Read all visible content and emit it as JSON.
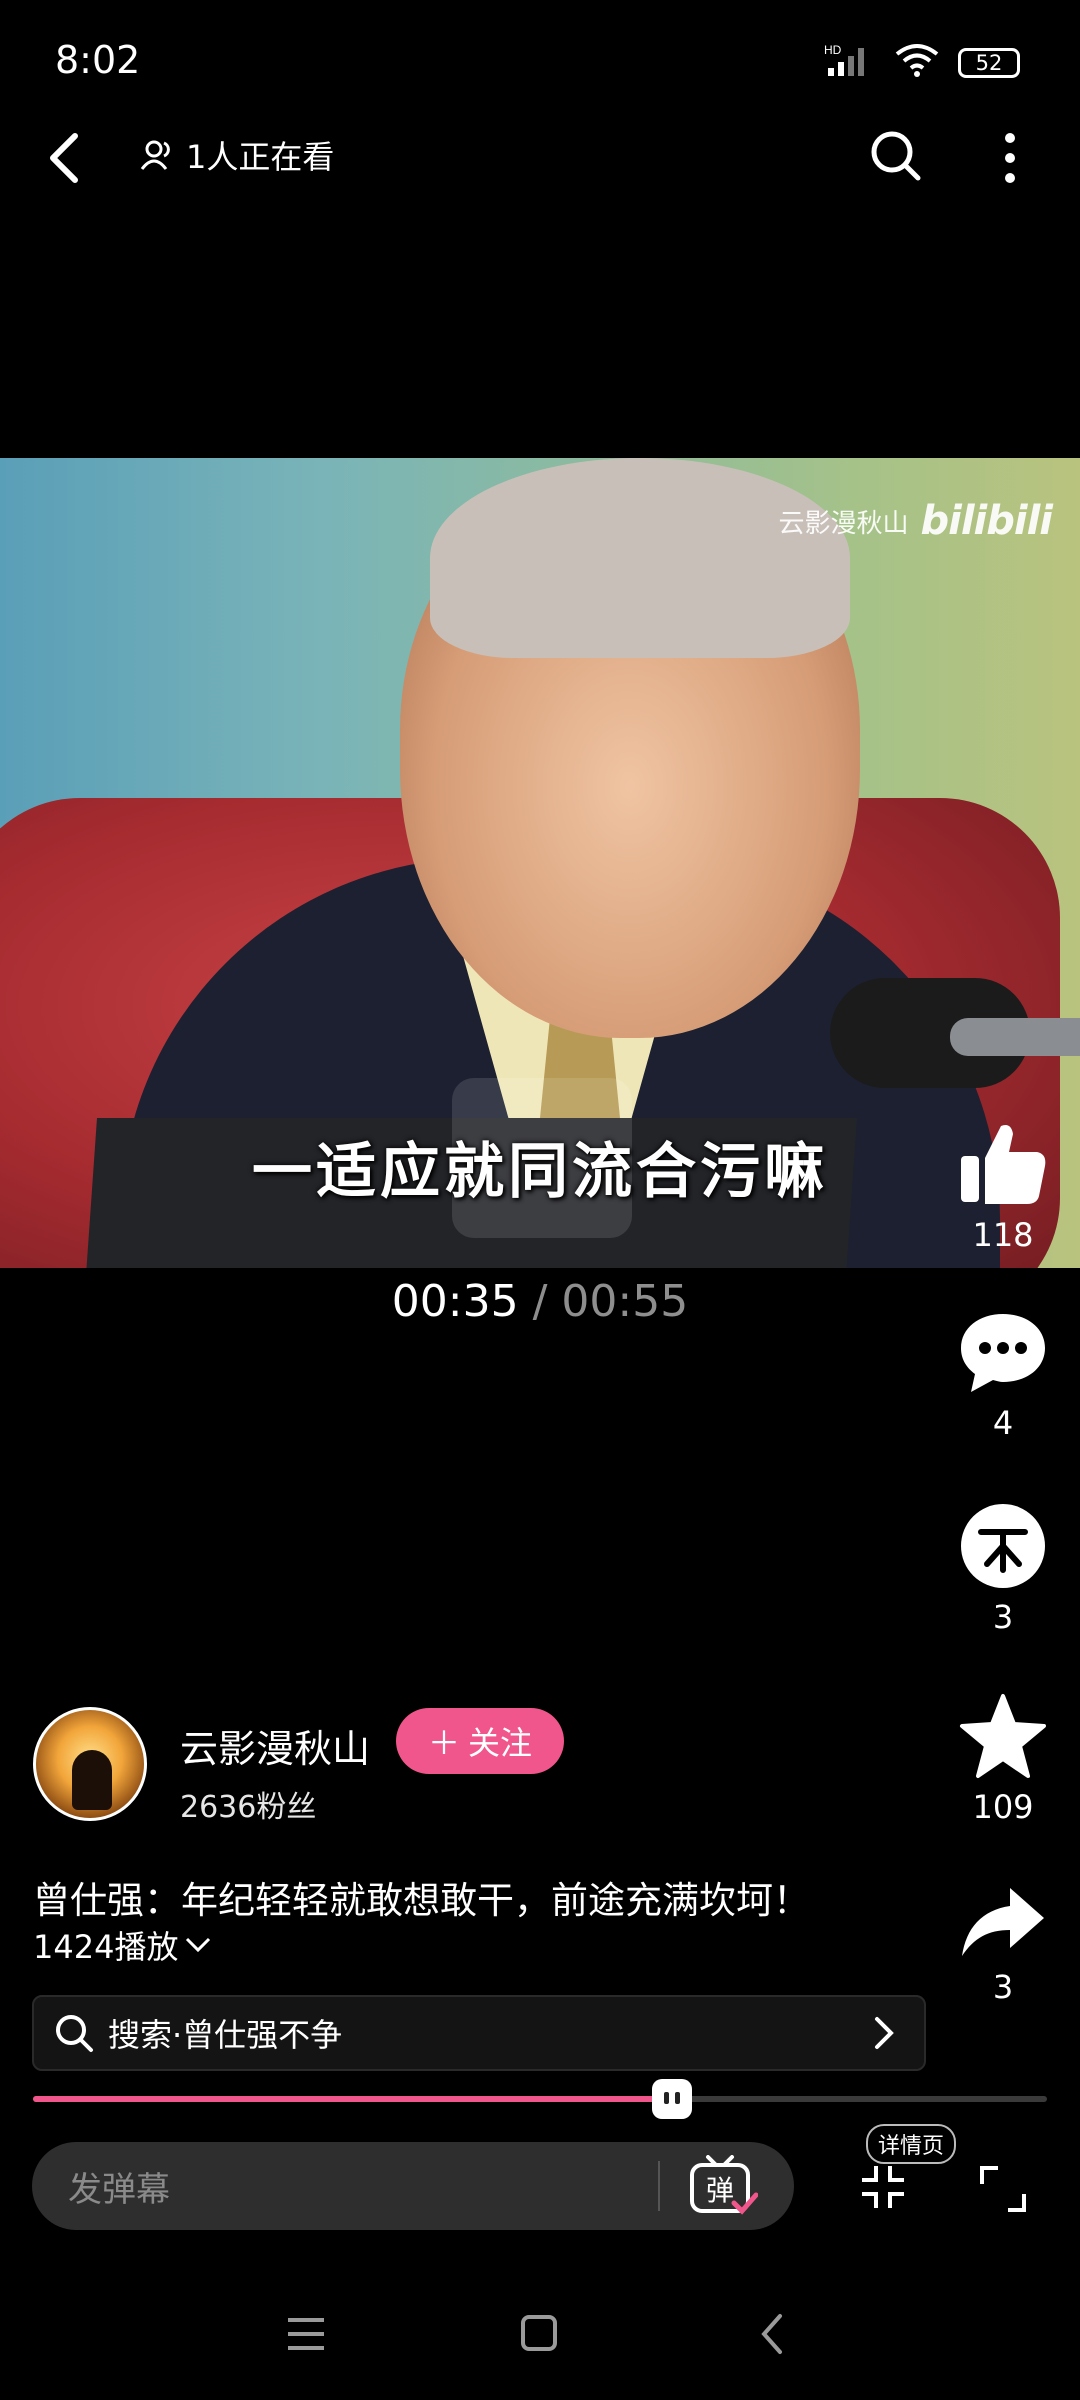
{
  "status": {
    "time": "8:02",
    "network": "HD",
    "battery": "52"
  },
  "topbar": {
    "watching": "1人正在看"
  },
  "video": {
    "watermark_channel": "云影漫秋山",
    "watermark_brand": "bilibili",
    "subtitle": "一适应就同流合污嘛"
  },
  "playback": {
    "current": "00:35",
    "separator": "/",
    "duration": "00:55",
    "progress": 0.63
  },
  "rail": {
    "likes": "118",
    "comments": "4",
    "coins": "3",
    "favorites": "109",
    "shares": "3"
  },
  "author": {
    "name": "云影漫秋山",
    "follow_label": "关注",
    "fans": "2636粉丝"
  },
  "title": "曾仕强：年纪轻轻就敢想敢干，前途充满坎坷！",
  "plays": "1424播放",
  "search": {
    "text": "搜索·曾仕强不争"
  },
  "danmaku": {
    "placeholder": "发弹幕",
    "button": "弹"
  },
  "detail_badge": "详情页",
  "colors": {
    "accent": "#f0568b",
    "background": "#000000"
  }
}
